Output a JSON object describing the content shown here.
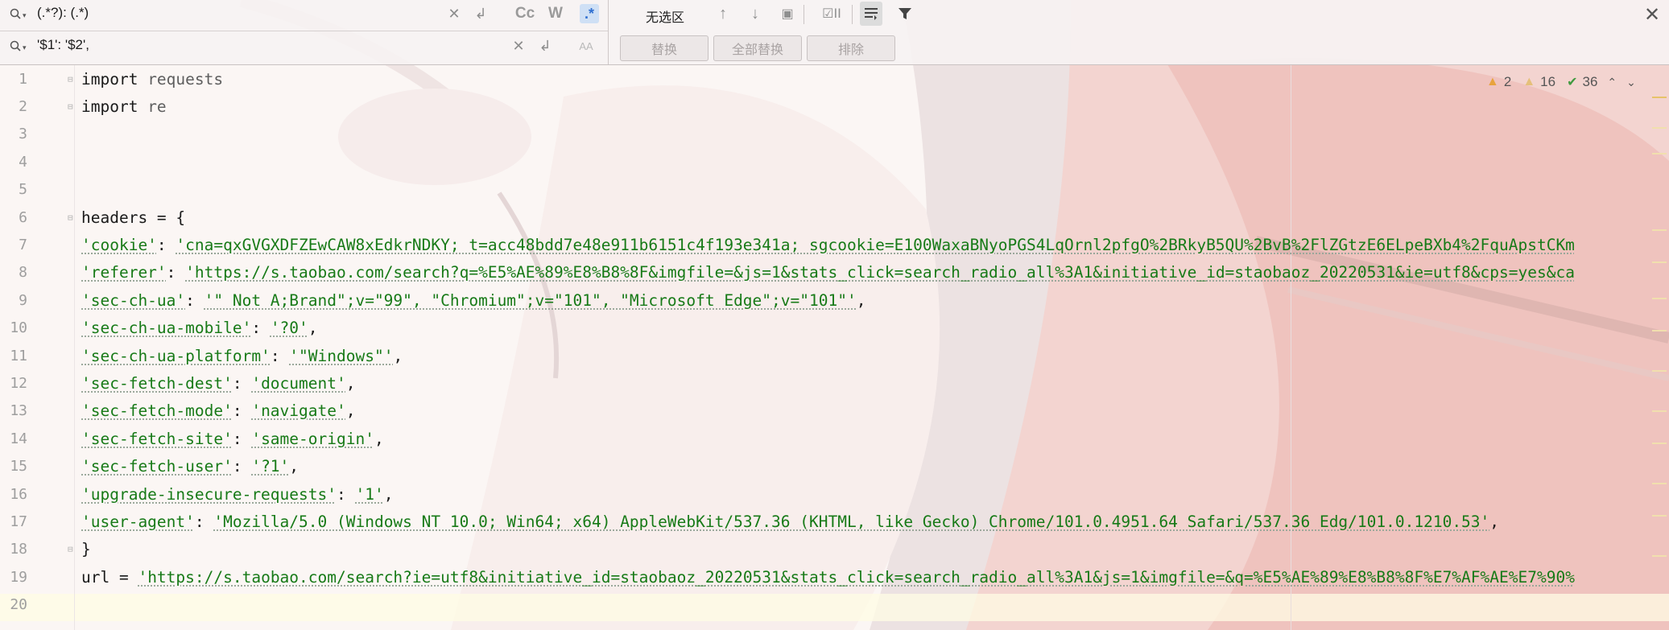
{
  "find": {
    "search_text": "(.*?): (.*)",
    "replace_text": "'$1': '$2',",
    "match_case_label": "Cc",
    "words_label": "W",
    "regex_label": ".*",
    "preserve_case_label": "AA",
    "selection_label": "无选区",
    "replace_button": "替换",
    "replace_all_button": "全部替换",
    "exclude_button": "排除"
  },
  "inspections": {
    "errors": "2",
    "warnings": "16",
    "ok": "36"
  },
  "colors": {
    "string": "#177a17",
    "line_number": "#9e9e9e",
    "regex_active_bg": "#cfe0f5"
  },
  "editor": {
    "line_numbers": [
      "1",
      "2",
      "3",
      "4",
      "5",
      "6",
      "7",
      "8",
      "9",
      "10",
      "11",
      "12",
      "13",
      "14",
      "15",
      "16",
      "17",
      "18",
      "19",
      "20"
    ],
    "lines": {
      "l1_kw": "import",
      "l1_mod": " requests",
      "l2_kw": "import",
      "l2_mod": " re",
      "l6": "headers = {",
      "l7_key": "'cookie'",
      "l7_sep": ": ",
      "l7_val": "'cna=qxGVGXDFZEwCAW8xEdkrNDKY; t=acc48bdd7e48e911b6151c4f193e341a; sgcookie=E100WaxaBNyoPGS4LqOrnl2pfgO%2BRkyB5QU%2BvB%2FlZGtzE6ELpeBXb4%2FquApstCKm",
      "l8_key": "'referer'",
      "l8_sep": ": ",
      "l8_val": "'https://s.taobao.com/search?q=%E5%AE%89%E8%B8%8F&imgfile=&js=1&stats_click=search_radio_all%3A1&initiative_id=staobaoz_20220531&ie=utf8&cps=yes&ca",
      "l9_key": "'sec-ch-ua'",
      "l9_sep": ": ",
      "l9_val": "'\" Not A;Brand\";v=\"99\", \"Chromium\";v=\"101\", \"Microsoft Edge\";v=\"101\"'",
      "l9_end": ",",
      "l10_key": "'sec-ch-ua-mobile'",
      "l10_sep": ": ",
      "l10_val": "'?0'",
      "l10_end": ",",
      "l11_key": "'sec-ch-ua-platform'",
      "l11_sep": ": ",
      "l11_val": "'\"Windows\"'",
      "l11_end": ",",
      "l12_key": "'sec-fetch-dest'",
      "l12_sep": ": ",
      "l12_val": "'document'",
      "l12_end": ",",
      "l13_key": "'sec-fetch-mode'",
      "l13_sep": ": ",
      "l13_val": "'navigate'",
      "l13_end": ",",
      "l14_key": "'sec-fetch-site'",
      "l14_sep": ": ",
      "l14_val": "'same-origin'",
      "l14_end": ",",
      "l15_key": "'sec-fetch-user'",
      "l15_sep": ": ",
      "l15_val": "'?1'",
      "l15_end": ",",
      "l16_key": "'upgrade-insecure-requests'",
      "l16_sep": ": ",
      "l16_val": "'1'",
      "l16_end": ",",
      "l17_key": "'user-agent'",
      "l17_sep": ": ",
      "l17_val": "'Mozilla/5.0 (Windows NT 10.0; Win64; x64) AppleWebKit/537.36 (KHTML, like Gecko) Chrome/101.0.4951.64 Safari/537.36 Edg/101.0.1210.53'",
      "l17_end": ",",
      "l18": "}",
      "l19_pre": "url = ",
      "l19_val": "'https://s.taobao.com/search?ie=utf8&initiative_id=staobaoz_20220531&stats_click=search_radio_all%3A1&js=1&imgfile=&q=%E5%AE%89%E8%B8%8F%E7%AF%AE%E7%90%"
    }
  }
}
